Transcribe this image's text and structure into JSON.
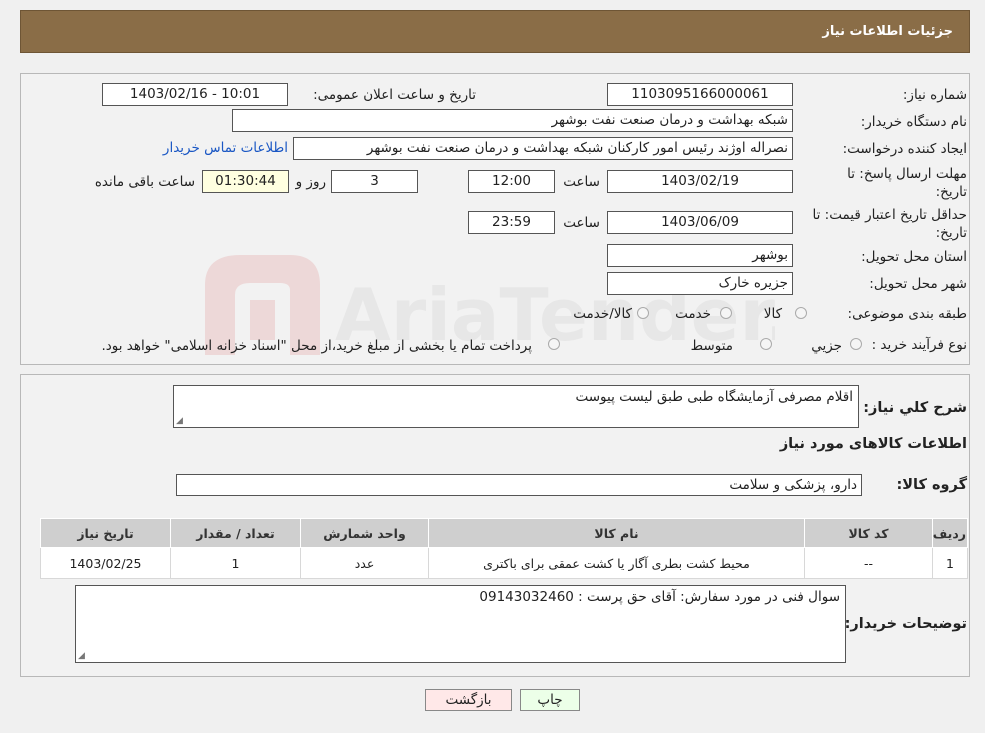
{
  "header": {
    "title": "جزئیات اطلاعات نیاز"
  },
  "fields": {
    "need_number_label": "شماره نیاز:",
    "need_number": "1103095166000061",
    "announce_label": "تاریخ و ساعت اعلان عمومی:",
    "announce_value": "1403/02/16 - 10:01",
    "buyer_org_label": "نام دستگاه خریدار:",
    "buyer_org": "شبکه بهداشت و درمان صنعت نفت بوشهر",
    "requester_label": "ایجاد کننده درخواست:",
    "requester": "نصراله اوژند رئیس امور کارکنان شبکه بهداشت و درمان صنعت نفت بوشهر",
    "contact_link": "اطلاعات تماس خریدار",
    "deadline_label_1": "مهلت ارسال پاسخ: تا",
    "deadline_label_2": "تاریخ:",
    "deadline_date": "1403/02/19",
    "time_label": "ساعت",
    "deadline_time": "12:00",
    "days_value": "3",
    "days_label": "روز و",
    "remaining_time": "01:30:44",
    "remaining_label": "ساعت باقی مانده",
    "validity_label_1": "حداقل تاریخ اعتبار قیمت: تا",
    "validity_label_2": "تاریخ:",
    "validity_date": "1403/06/09",
    "validity_time_label": "ساعت",
    "validity_time": "23:59",
    "province_label": "استان محل تحویل:",
    "province": "بوشهر",
    "city_label": "شهر محل تحویل:",
    "city": "جزیره خارک",
    "category_label": "طبقه بندی موضوعی:",
    "category_options": [
      "کالا",
      "خدمت",
      "کالا/خدمت"
    ],
    "process_label": "نوع فرآیند خرید :",
    "process_options": [
      "جزیي",
      "متوسط"
    ],
    "process_note": "پرداخت تمام یا بخشی از مبلغ خرید،از محل \"اسناد خزانه اسلامی\" خواهد بود."
  },
  "summary": {
    "label": "شرح كلي نیاز:",
    "value": "اقلام مصرفی آزمایشگاه طبی طبق لیست پیوست",
    "items_title": "اطلاعات کالاهای مورد نیاز",
    "group_label": "گروه کالا:",
    "group_value": "دارو، پزشکی و سلامت"
  },
  "table": {
    "headers": [
      "ردیف",
      "کد کالا",
      "نام کالا",
      "واحد شمارش",
      "تعداد / مقدار",
      "تاریخ نیاز"
    ],
    "rows": [
      [
        "1",
        "--",
        "محیط کشت بطری آگار یا کشت عمقی برای باکتری",
        "عدد",
        "1",
        "1403/02/25"
      ]
    ]
  },
  "buyer_notes": {
    "label": "توضیحات خریدار:",
    "value": "سوال فنی در مورد سفارش: آقای حق پرست : 09143032460"
  },
  "buttons": {
    "print": "چاپ",
    "back": "بازگشت"
  },
  "watermark": {
    "text": "AriaTender.neT"
  }
}
